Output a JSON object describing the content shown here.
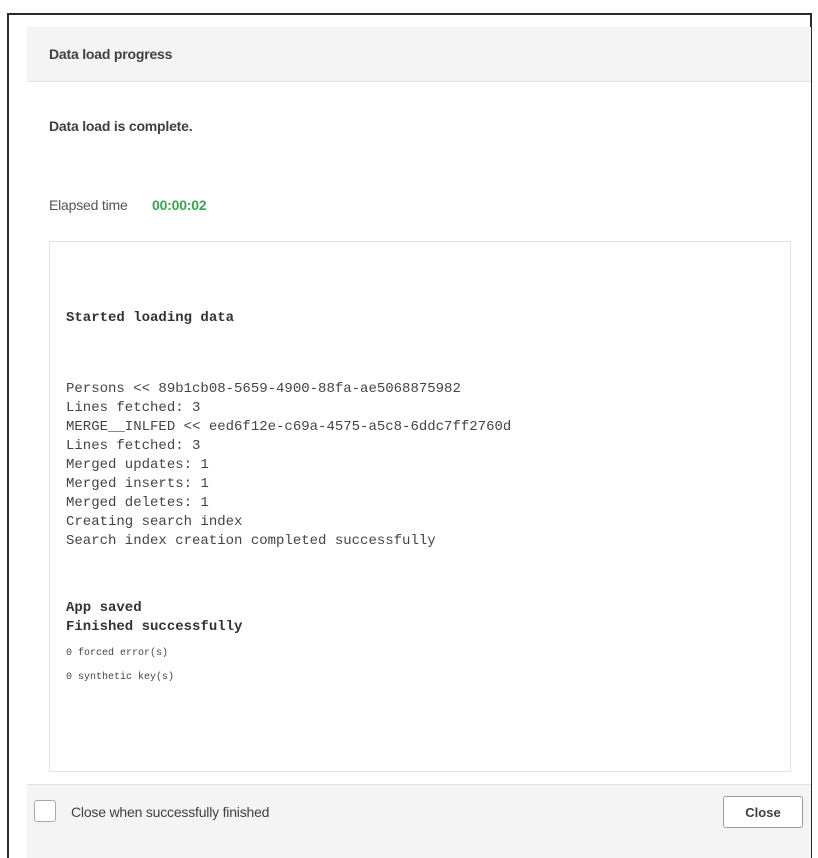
{
  "dialog": {
    "title": "Data load progress",
    "status_message": "Data load is complete.",
    "elapsed": {
      "label": "Elapsed time",
      "value": "00:00:02",
      "value_color": "#3fa34d"
    }
  },
  "log": {
    "lines": [
      "Started loading data",
      "Persons << 89b1cb08-5659-4900-88fa-ae5068875982",
      "Lines fetched: 3",
      "MERGE__INLFED << eed6f12e-c69a-4575-a5c8-6ddc7ff2760d",
      "Lines fetched: 3",
      "Merged updates: 1",
      "Merged inserts: 1",
      "Merged deletes: 1",
      "Creating search index",
      "Search index creation completed successfully",
      "App saved",
      "Finished successfully",
      "0 forced error(s)",
      "0 synthetic key(s)"
    ]
  },
  "footer": {
    "checkbox_label": "Close when successfully finished",
    "checkbox_checked": false,
    "close_button_label": "Close"
  }
}
